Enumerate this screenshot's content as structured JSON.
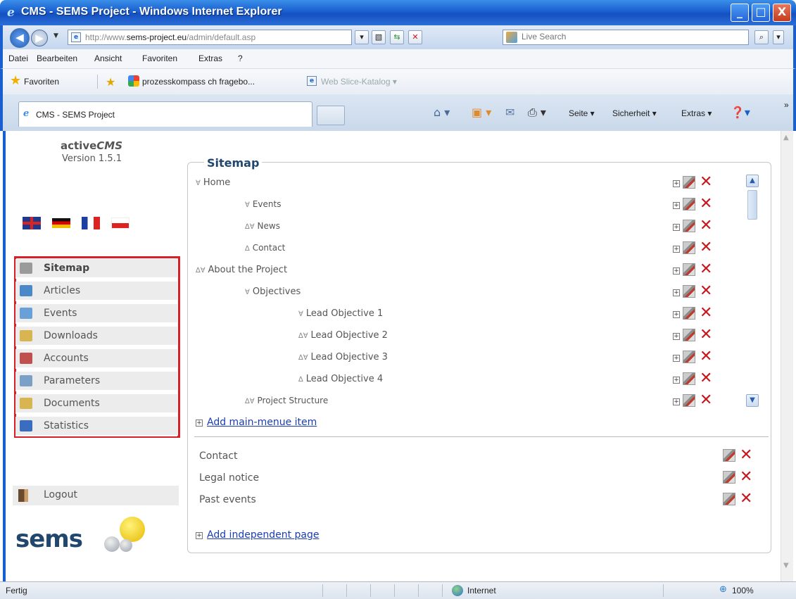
{
  "window": {
    "title": "CMS - SEMS Project - Windows Internet Explorer",
    "minimize": "_",
    "maximize": "□",
    "close": "X"
  },
  "address": {
    "url_prefix": "http://www.",
    "url_domain": "sems-project.eu",
    "url_path": "/admin/default.asp",
    "search_placeholder": "Live Search"
  },
  "menu": [
    "Datei",
    "Bearbeiten",
    "Ansicht",
    "Favoriten",
    "Extras",
    "?"
  ],
  "favorites": {
    "label": "Favoriten",
    "link1": "prozesskompass ch fragebo...",
    "link2": "Web Slice-Katalog ▾"
  },
  "tab": {
    "label": "CMS - SEMS Project"
  },
  "commands": {
    "page": "Seite ▾",
    "security": "Sicherheit ▾",
    "extras": "Extras ▾",
    "more": "»"
  },
  "cms": {
    "title_plain": "active",
    "title_italic": "CMS",
    "version": "Version 1.5.1"
  },
  "nav": [
    {
      "label": "Sitemap",
      "icon": "sitemap-icon",
      "color": "#9a9a9a"
    },
    {
      "label": "Articles",
      "icon": "articles-icon",
      "color": "#4a88c8"
    },
    {
      "label": "Events",
      "icon": "calendar-icon",
      "color": "#6aa0d8"
    },
    {
      "label": "Downloads",
      "icon": "folder-icon",
      "color": "#d8b550"
    },
    {
      "label": "Accounts",
      "icon": "users-icon",
      "color": "#c0504d"
    },
    {
      "label": "Parameters",
      "icon": "parameters-icon",
      "color": "#7aa0c8"
    },
    {
      "label": "Documents",
      "icon": "folder-icon",
      "color": "#d8b550"
    },
    {
      "label": "Statistics",
      "icon": "bar-chart-icon",
      "color": "#3a6cc0"
    }
  ],
  "logout": "Logout",
  "logo": "sems",
  "sitemap": {
    "title": "Sitemap",
    "rows": [
      {
        "label": "Home",
        "ctrl": "∀"
      },
      {
        "label": "Events",
        "ctrl": "∀"
      },
      {
        "label": "News",
        "ctrl": "∆∀"
      },
      {
        "label": "Contact",
        "ctrl": "∆"
      },
      {
        "label": "About the Project",
        "ctrl": "∆∀"
      },
      {
        "label": "Objectives",
        "ctrl": "∀"
      },
      {
        "label": "Lead Objective 1",
        "ctrl": "∀"
      },
      {
        "label": "Lead Objective 2",
        "ctrl": "∆∀"
      },
      {
        "label": "Lead Objective 3",
        "ctrl": "∆∀"
      },
      {
        "label": "Lead Objective 4",
        "ctrl": "∆"
      },
      {
        "label": "Project Structure",
        "ctrl": "∆∀"
      }
    ],
    "add_main": "Add main-menue item",
    "pages": [
      "Contact",
      "Legal notice",
      "Past events"
    ],
    "add_independent": "Add independent page"
  },
  "status": {
    "text": "Fertig",
    "zone": "Internet",
    "zoom": "100%"
  }
}
